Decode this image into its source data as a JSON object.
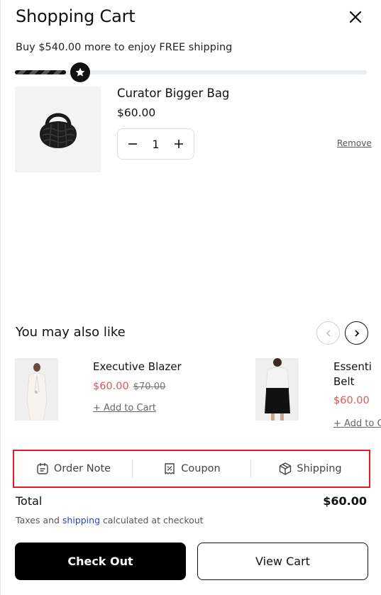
{
  "cart": {
    "title": "Shopping Cart",
    "shipping_message": "Buy $540.00 more to enjoy FREE shipping",
    "progress_fraction": 0.1,
    "items": [
      {
        "name": "Curator Bigger Bag",
        "price": "$60.00",
        "quantity": "1",
        "remove_label": "Remove"
      }
    ]
  },
  "recommendations": {
    "title": "You may also like",
    "products": [
      {
        "name": "Executive Blazer",
        "price": "$60.00",
        "old_price": "$70.00",
        "add_label": "+ Add to Cart"
      },
      {
        "name": "Essenti\nBelt",
        "price": "$60.00",
        "old_price": "",
        "add_label": "+ Add to Cart"
      }
    ]
  },
  "tools": {
    "order_note": "Order Note",
    "coupon": "Coupon",
    "shipping": "Shipping"
  },
  "summary": {
    "total_label": "Total",
    "total_value": "$60.00",
    "tax_prefix": "Taxes and ",
    "tax_link": "shipping",
    "tax_suffix": " calculated at checkout"
  },
  "actions": {
    "checkout_label": "Check Out",
    "view_cart_label": "View Cart"
  },
  "icons": {
    "close": "close-icon",
    "star": "star-icon",
    "minus": "minus-icon",
    "plus": "plus-icon",
    "prev": "chevron-left-icon",
    "next": "chevron-right-icon",
    "order_note": "note-icon",
    "coupon": "coupon-icon",
    "shipping": "box-icon"
  },
  "colors": {
    "sale_price": "#e05555",
    "link": "#2e3fd1",
    "highlight_border": "#e01b24",
    "primary_button": "#000000"
  }
}
